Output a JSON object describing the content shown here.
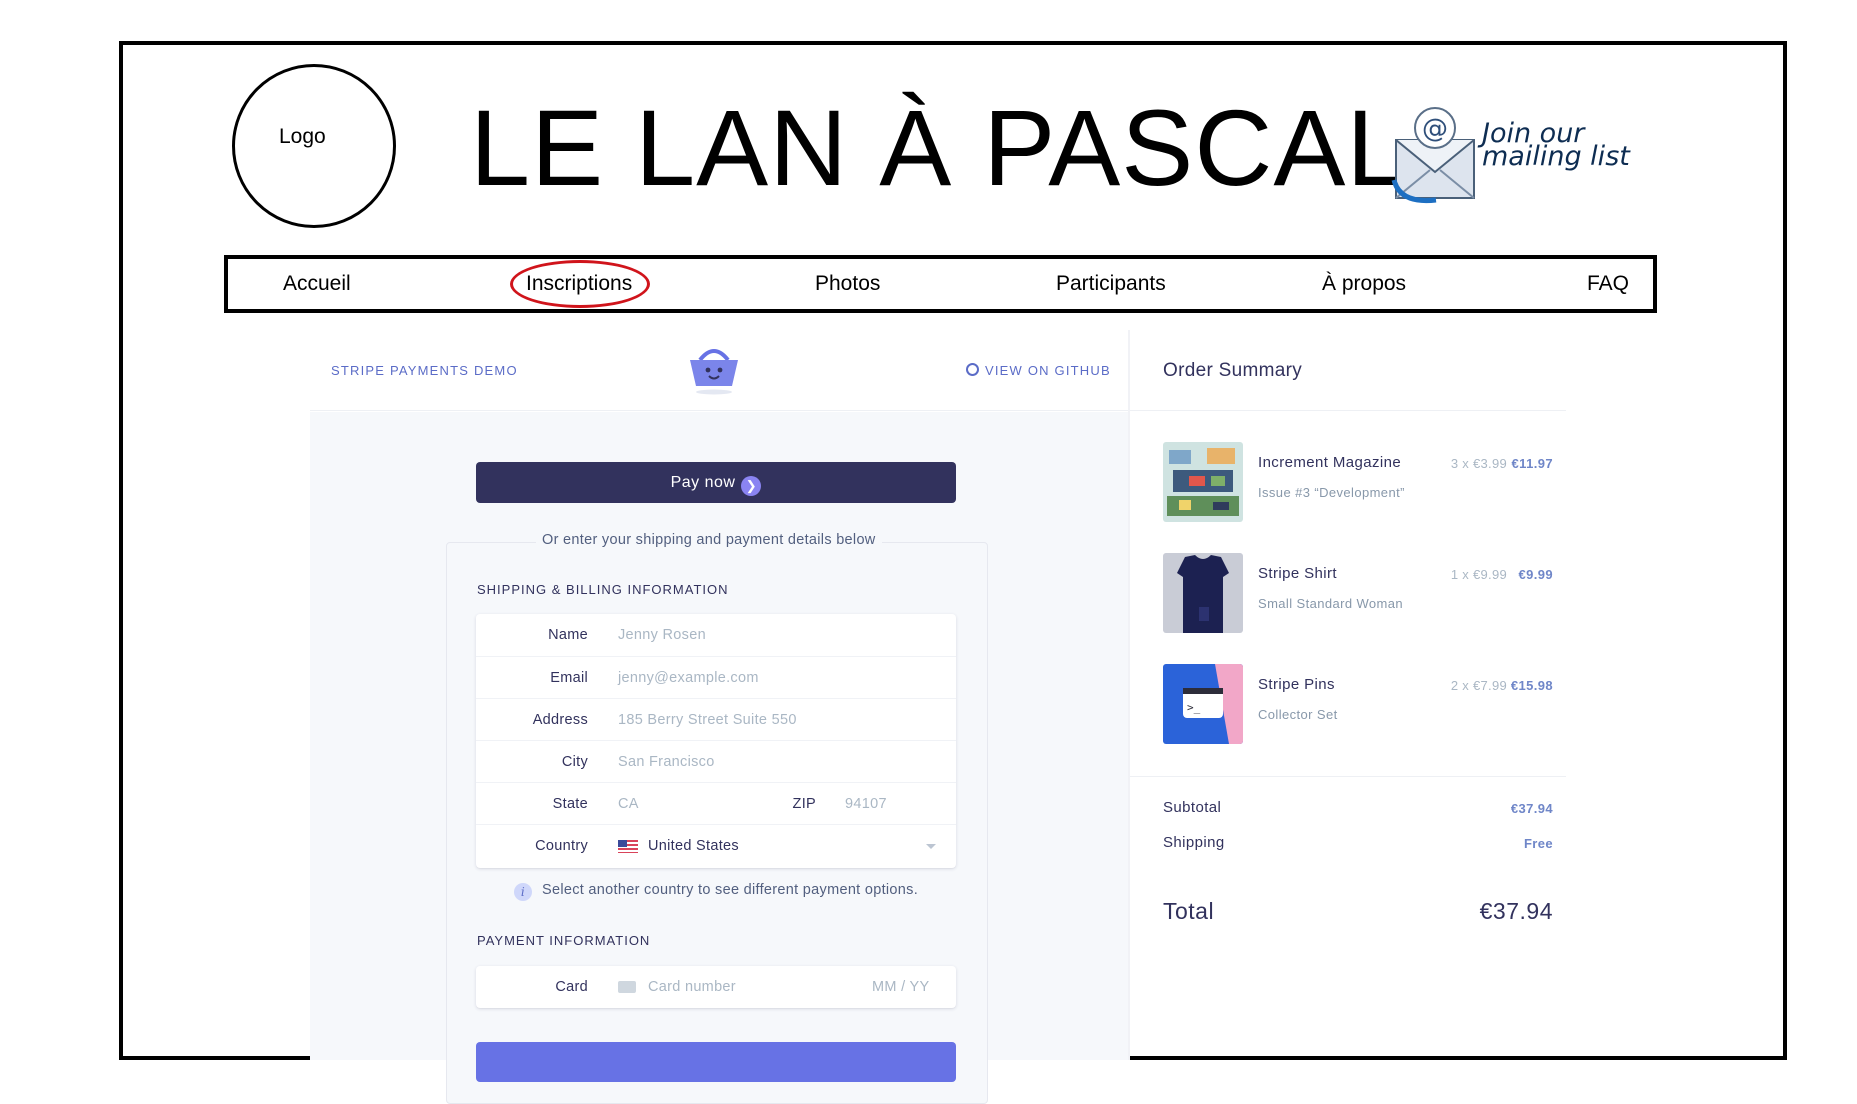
{
  "header": {
    "logo_text": "Logo",
    "site_title": "LE LAN À PASCAL",
    "mailing_line1": "Join our",
    "mailing_line2": "mailing list"
  },
  "nav": {
    "items": [
      {
        "label": "Accueil"
      },
      {
        "label": "Inscriptions",
        "highlighted": true
      },
      {
        "label": "Photos"
      },
      {
        "label": "Participants"
      },
      {
        "label": "À propos"
      },
      {
        "label": "FAQ"
      }
    ],
    "highlight_color": "#d0141b"
  },
  "demo": {
    "label": "STRIPE PAYMENTS DEMO",
    "github": "VIEW ON GITHUB",
    "basket_icon": "basket-icon",
    "pay_now": "Pay now",
    "or_text": "Or enter your shipping and payment details below",
    "shipping_title": "SHIPPING & BILLING INFORMATION",
    "fields": {
      "name": {
        "label": "Name",
        "placeholder": "Jenny Rosen"
      },
      "email": {
        "label": "Email",
        "placeholder": "jenny@example.com"
      },
      "address": {
        "label": "Address",
        "placeholder": "185 Berry Street Suite 550"
      },
      "city": {
        "label": "City",
        "placeholder": "San Francisco"
      },
      "state": {
        "label": "State",
        "placeholder": "CA"
      },
      "zip": {
        "label": "ZIP",
        "placeholder": "94107"
      },
      "country": {
        "label": "Country",
        "value": "United States"
      }
    },
    "country_notice": "Select another country to see different payment options.",
    "payment_title": "PAYMENT INFORMATION",
    "card": {
      "label": "Card",
      "placeholder": "Card number",
      "expiry": "MM / YY"
    },
    "accent": "#32325d",
    "primary": "#6772e5"
  },
  "order": {
    "title": "Order Summary",
    "items": [
      {
        "name": "Increment Magazine",
        "desc": "Issue #3 “Development”",
        "qty": "3 x €3.99",
        "price": "€11.97"
      },
      {
        "name": "Stripe Shirt",
        "desc": "Small Standard Woman",
        "qty": "1 x €9.99",
        "price": "€9.99"
      },
      {
        "name": "Stripe Pins",
        "desc": "Collector Set",
        "qty": "2 x €7.99",
        "price": "€15.98"
      }
    ],
    "subtotal_label": "Subtotal",
    "subtotal": "€37.94",
    "shipping_label": "Shipping",
    "shipping": "Free",
    "total_label": "Total",
    "total": "€37.94"
  }
}
